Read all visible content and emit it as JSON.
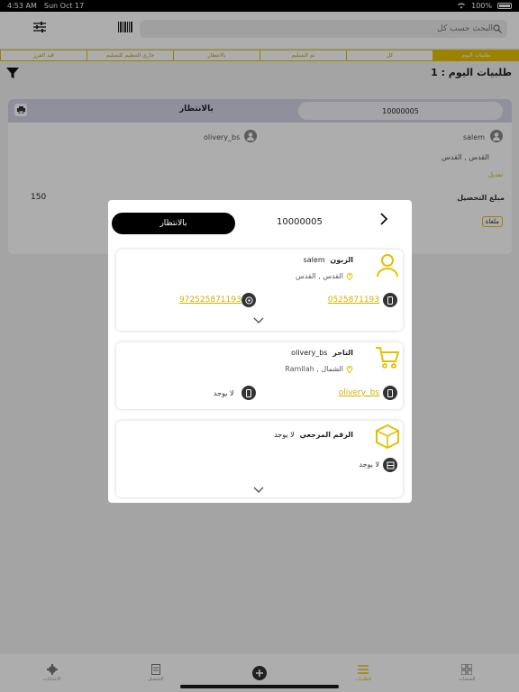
{
  "status_bar": {
    "time": "4:53 AM",
    "date": "Sun Oct 17",
    "battery": "100%"
  },
  "search": {
    "placeholder": "البحث حسب كل"
  },
  "tabs": [
    "طلبيات اليوم",
    "كل",
    "تم التسليم",
    "بالانتظار",
    "جاري التنظيم للتسليم",
    "قيد الفرز"
  ],
  "today_count_label": "طلبيات اليوم : 1",
  "background_order": {
    "id": "10000005",
    "status": "بالانتظار",
    "customer": "salem",
    "merchant": "olivery_bs",
    "location": "القدس , القدس",
    "edit_label": "تعديل",
    "amount_label": "مبلغ التحصيل",
    "amount": "150",
    "cancelled_badge": "ملغاة"
  },
  "bottom_nav": [
    {
      "label": "الشحنات",
      "icon": "grid-icon"
    },
    {
      "label": "الطلبيات",
      "icon": "list-icon"
    },
    {
      "label": "",
      "icon": "add-icon"
    },
    {
      "label": "التحصيل",
      "icon": "document-icon"
    },
    {
      "label": "الاعدادات",
      "icon": "gear-icon"
    }
  ],
  "modal": {
    "order_id": "10000005",
    "status": "بالانتظار",
    "customer": {
      "title": "الزبون",
      "name": "salem",
      "location": "القدس , القدس",
      "phone": "0525871193",
      "whatsapp": "972525871193"
    },
    "merchant": {
      "title": "التاجر",
      "name": "olivery_bs",
      "location": "الشمال , Ramllah",
      "phone": "olivery_bs",
      "second_phone": "لا يوجد"
    },
    "reference": {
      "title": "الرقم المرجعي",
      "value": "لا يوجد",
      "detail": "لا يوجد"
    }
  },
  "colors": {
    "accent": "#e5c000",
    "dark": "#000000"
  }
}
